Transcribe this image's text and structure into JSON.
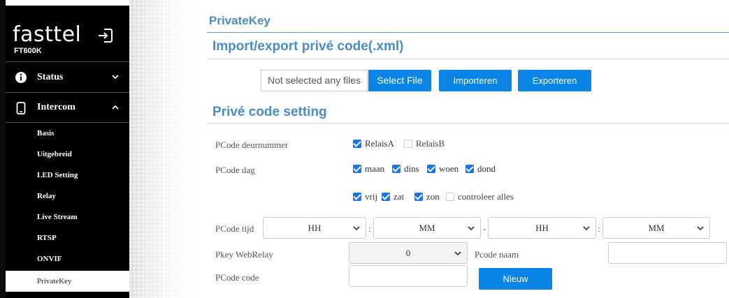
{
  "sidebar": {
    "brand": "fasttel",
    "model": "FT600K",
    "nav": [
      {
        "label": "Status"
      },
      {
        "label": "Intercom"
      }
    ],
    "sub_items": [
      "Basis",
      "Uitgebreid",
      "LED Setting",
      "Relay",
      "Live Stream",
      "RTSP",
      "ONVIF",
      "PrivateKey"
    ],
    "active_item": "PrivateKey"
  },
  "main": {
    "page_title": "PrivateKey",
    "import_section": {
      "title": "Import/export privé code(.xml)",
      "file_placeholder": "Not selected any files",
      "select_label": "Select File",
      "import_label": "Importeren",
      "export_label": "Exporteren"
    },
    "setting_section": {
      "title": "Privé code setting",
      "door_label": "PCode deurnummer",
      "door_options": [
        {
          "label": "RelaisA",
          "checked": true
        },
        {
          "label": "RelaisB",
          "checked": false
        }
      ],
      "day_label": "PCode dag",
      "days_row1": [
        {
          "label": "maan",
          "checked": true
        },
        {
          "label": "dins",
          "checked": true
        },
        {
          "label": "woen",
          "checked": true
        },
        {
          "label": "dond",
          "checked": true
        }
      ],
      "days_row2": [
        {
          "label": "vrij",
          "checked": true
        },
        {
          "label": "zat",
          "checked": true
        },
        {
          "label": "zon",
          "checked": true
        },
        {
          "label": "controleer alles",
          "checked": false
        }
      ],
      "time_label": "PCode tijd",
      "time_selects": [
        "HH",
        "MM",
        "HH",
        "MM"
      ],
      "time_sep_colon": ":",
      "time_sep_dash": "-",
      "webrelay_label": "Pkey WebRelay",
      "webrelay_value": "0",
      "name_label": "Pcode naam",
      "name_value": "",
      "code_label": "PCode code",
      "code_value": "",
      "new_label": "Nieuw"
    }
  },
  "colors": {
    "accent": "#4a8cc8",
    "button": "#0a84e6",
    "sidebar_bg": "#000000"
  }
}
